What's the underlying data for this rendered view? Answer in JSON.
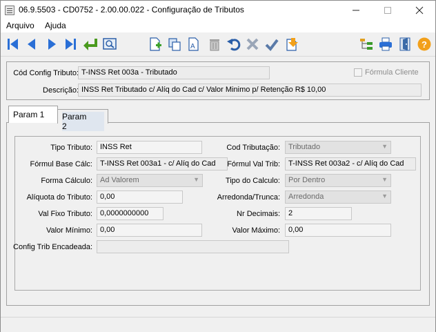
{
  "window": {
    "title": "06.9.5503 - CD0752 - 2.00.00.022 - Configuração de Tributos",
    "minimize_icon": "minimize-icon",
    "maximize_icon": "maximize-icon",
    "close_icon": "close-icon"
  },
  "menu": [
    {
      "label": "Arquivo"
    },
    {
      "label": "Ajuda"
    }
  ],
  "toolbar": {
    "buttons": [
      "first-record-icon",
      "previous-record-icon",
      "next-record-icon",
      "last-record-icon",
      "enter-icon",
      "search-window-icon",
      "new-document-icon",
      "copy-icon",
      "edit-text-icon",
      "delete-icon",
      "undo-icon",
      "cancel-icon",
      "confirm-icon",
      "export-icon",
      "tree-structure-icon",
      "printer-icon",
      "exit-door-icon",
      "help-icon"
    ]
  },
  "header": {
    "cod_config_label": "Cód Config Tributo:",
    "cod_config_value": "T-INSS Ret 003a - Tributado",
    "formula_cliente_label": "Fórmula Cliente",
    "formula_cliente_checked": false,
    "descricao_label": "Descrição:",
    "descricao_value": "INSS Ret Tributado c/ Alíq do Cad c/ Valor Minimo p/ Retenção R$ 10,00"
  },
  "tabs": [
    {
      "label": "Param 1",
      "active": true
    },
    {
      "label": "Param 2",
      "active": false
    }
  ],
  "param1": {
    "tipo_tributo_label": "Tipo Tributo:",
    "tipo_tributo_value": "INSS Ret",
    "cod_tributacao_label": "Cod Tributação:",
    "cod_tributacao_value": "Tributado",
    "formul_base_label": "Fórmul Base Cálc:",
    "formul_base_value": "T-INSS Ret 003a1 - c/ Alíq do Cad",
    "formul_val_label": "Fórmul Val Trib:",
    "formul_val_value": "T-INSS Ret 003a2 - c/ Alíq do Cad",
    "forma_calculo_label": "Forma Cálculo:",
    "forma_calculo_value": "Ad Valorem",
    "tipo_calculo_label": "Tipo do Calculo:",
    "tipo_calculo_value": "Por Dentro",
    "aliquota_label": "Alíquota do Tributo:",
    "aliquota_value": "0,00",
    "arredonda_label": "Arredonda/Trunca:",
    "arredonda_value": "Arredonda",
    "val_fixo_label": "Val Fixo Tributo:",
    "val_fixo_value": "0,0000000000",
    "nr_decimais_label": "Nr Decimais:",
    "nr_decimais_value": "2",
    "valor_minimo_label": "Valor Mínimo:",
    "valor_minimo_value": "0,00",
    "valor_maximo_label": "Valor Máximo:",
    "valor_maximo_value": "0,00",
    "config_encadeada_label": "Config Trib Encadeada:",
    "config_encadeada_value": ""
  }
}
